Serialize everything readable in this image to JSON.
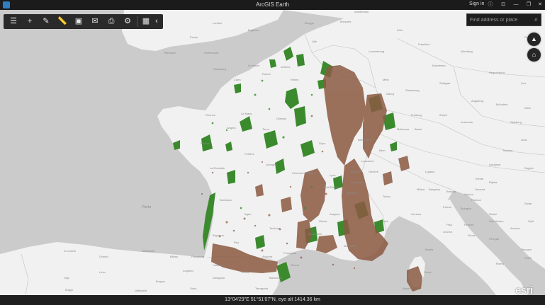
{
  "window": {
    "title": "ArcGIS Earth",
    "sign_in": "Sign in",
    "controls": [
      "ⓘ",
      "⊡",
      "—",
      "❐",
      "✕"
    ]
  },
  "toolbar": {
    "tools": [
      {
        "name": "layers-icon",
        "glyph": "☰"
      },
      {
        "name": "add-icon",
        "glyph": "+"
      },
      {
        "name": "draw-icon",
        "glyph": "✎"
      },
      {
        "name": "measure-icon",
        "glyph": "📏"
      },
      {
        "name": "picture-icon",
        "glyph": "▣"
      },
      {
        "name": "mail-icon",
        "glyph": "✉"
      },
      {
        "name": "print-icon",
        "glyph": "⎙"
      },
      {
        "name": "settings-icon",
        "glyph": "⚙"
      },
      {
        "name": "grid-icon",
        "glyph": "▦"
      },
      {
        "name": "collapse-icon",
        "glyph": "‹"
      }
    ]
  },
  "search": {
    "placeholder": "Find address or place",
    "icon": "search-icon"
  },
  "nav": {
    "compass_glyph": "▲",
    "home_glyph": "⌂"
  },
  "status": {
    "coords": "13°04'29\"E  51°51'07\"N,  eye alt 1414.36 km"
  },
  "logo": "esri",
  "colors": {
    "land": "#f1f1f1",
    "sea": "#cbcbcb",
    "forest": "#3b8a2e",
    "mountain": "#8b5a42",
    "titlebar": "#1b1b1b"
  },
  "map_labels": {
    "plymouth": "Plymouth",
    "cherbourg": "Cherbourg",
    "rennes": "Rennes",
    "nantes": "Nantes",
    "la_rochelle": "La Rochelle",
    "bordeaux": "Bordeaux",
    "toulouse": "Toulouse",
    "montpellier": "Montpellier",
    "marseille": "Marseille",
    "nice": "Nice",
    "lyon": "Lyon",
    "geneva": "Genève",
    "bern": "Bern",
    "zurich": "Zürich",
    "munich": "München",
    "strasbourg": "Strasbourg",
    "frankfurt": "Frankfurt",
    "brussels": "Brussels",
    "amsterdam": "Amsterdam",
    "milan": "Milano",
    "torino": "Torino",
    "genova": "Genova",
    "bologna": "Bologna",
    "firenze": "Firenze",
    "venezia": "Venezia",
    "zagreb": "Zagreb",
    "ljubljana": "Ljubljana",
    "wien": "Wien",
    "praha": "Praha",
    "roma": "Roma",
    "bilbao": "Bilbao",
    "barcelona": "Barcelona",
    "zaragoza": "Zaragoza",
    "andorra": "Andorra",
    "oviedo": "Oviedo",
    "valladolid": "Valladolid",
    "porto": "Porto",
    "madrid": "Madrid",
    "corse": "Corse",
    "ajaccio": "Ajaccio",
    "pamplona": "Pamplona",
    "santander": "Santander",
    "burgos": "Burgos",
    "caen": "Caen",
    "le_mans": "Le Mans",
    "tours": "Tours",
    "limoges": "Limoges",
    "clermont": "Clermont-Ferrand",
    "dijon": "Dijon",
    "besancon": "Besançon",
    "reims": "Reims",
    "lille": "Lille",
    "luxembourg": "Luxembourg",
    "stuttgart": "Stuttgart",
    "nurnberg": "Nürnberg",
    "salzburg": "Salzburg",
    "innsbruck": "Innsbruck",
    "verona": "Verona",
    "trieste": "Trieste",
    "parma": "Parma",
    "ancona": "Ancona",
    "perugia": "Perugia",
    "pescara": "Pescara",
    "split": "Split",
    "bastia": "Bastia",
    "sassari": "Sassari",
    "olbia": "Olbia",
    "palma": "Palma",
    "valencia": "Valencia",
    "lleida": "Lleida",
    "tarragona": "Tarragona",
    "girona": "Girona",
    "perpignan": "Perpignan",
    "pau": "Pau",
    "bayonne": "Bayonne",
    "agen": "Agen",
    "nimes": "Nîmes",
    "avignon": "Avignon",
    "grenoble": "Grenoble",
    "chambery": "Chambéry",
    "annecy": "Annecy",
    "st_etienne": "Saint-Étienne",
    "angers": "Angers",
    "poitiers": "Poitiers",
    "orleans": "Orléans",
    "amiens": "Amiens",
    "le_havre": "Le Havre",
    "rouen": "Rouen",
    "metz": "Metz",
    "nancy": "Nancy",
    "mulhouse": "Mulhouse",
    "basel": "Basel",
    "lausanne": "Lausanne",
    "lugano": "Lugano",
    "leon": "León",
    "braga": "Braga",
    "vigo": "Vigo",
    "coruna": "A Coruña",
    "soria": "Soria",
    "logrono": "Logroño",
    "huesca": "Huesca",
    "teruel": "Teruel",
    "bruges": "Brugge",
    "london": "London",
    "brighton": "Brighton",
    "portsmouth": "Portsmouth",
    "exeter": "Exeter",
    "koln": "Köln",
    "mannheim": "Mannheim",
    "freiburg": "Freiburg",
    "augsburg": "Augsburg",
    "regensburg": "Regensburg",
    "linz": "Linz",
    "graz": "Graz",
    "maribor": "Maribor",
    "rijeka": "Rijeka",
    "padova": "Padova",
    "brescia": "Brescia",
    "bergamo": "Bergamo",
    "rimini": "Rimini",
    "pisa": "Pisa",
    "livorno": "Livorno",
    "siena": "Siena",
    "san_marino": "San Marino",
    "zadar": "Zadar",
    "chieti": "Chieti",
    "bari": "Bari",
    "napoli": "Napoli",
    "cagliari": "Cagliari"
  }
}
